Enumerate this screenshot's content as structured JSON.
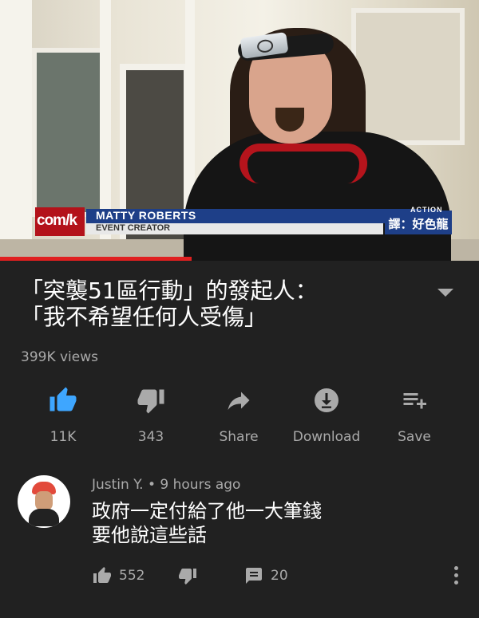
{
  "video": {
    "lower_third_site": "com/k",
    "lower_third_name": "MATTY ROBERTS",
    "lower_third_title": "EVENT CREATOR",
    "lower_third_brand": "ACTION",
    "translator_credit": "譯：好色龍",
    "progress_fraction": 0.4
  },
  "title": "「突襲51區行動」的發起人：\n「我不希望任何人受傷」",
  "views": "399K views",
  "actions": {
    "like": "11K",
    "dislike": "343",
    "share": "Share",
    "download": "Download",
    "save": "Save"
  },
  "comment": {
    "author": "Justin Y.",
    "separator": "•",
    "time": "9 hours ago",
    "text": "政府一定付給了他一大筆錢\n要他說這些話",
    "likes": "552",
    "replies": "20"
  },
  "colors": {
    "background": "#212121",
    "accent": "#3ea6ff",
    "secondary_text": "#aaaaaa",
    "progress": "#e02020"
  }
}
